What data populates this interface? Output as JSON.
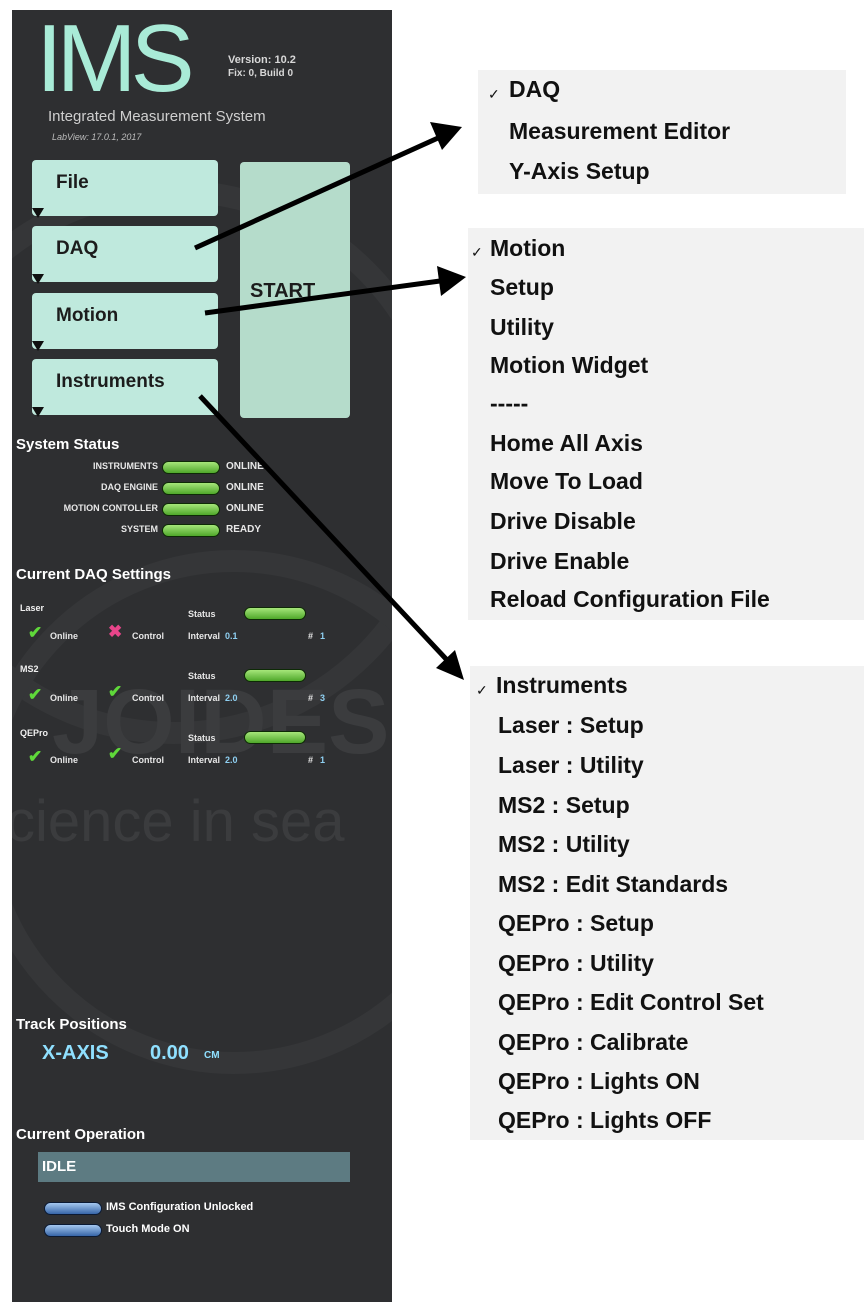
{
  "app": {
    "logo": "IMS",
    "version": "Version: 10.2",
    "build": "Fix: 0, Build 0",
    "subtitle": "Integrated Measurement System",
    "labview": "LabView: 17.0.1, 2017"
  },
  "background_watermark": {
    "text1": "JOIDES",
    "text2": "cience in sea"
  },
  "menu_buttons": [
    {
      "label": "File"
    },
    {
      "label": "DAQ"
    },
    {
      "label": "Motion"
    },
    {
      "label": "Instruments"
    }
  ],
  "start_button": {
    "label": "START"
  },
  "system_status": {
    "heading": "System Status",
    "rows": [
      {
        "label": "INSTRUMENTS",
        "value": "ONLINE"
      },
      {
        "label": "DAQ ENGINE",
        "value": "ONLINE"
      },
      {
        "label": "MOTION CONTOLLER",
        "value": "ONLINE"
      },
      {
        "label": "SYSTEM",
        "value": "READY"
      }
    ]
  },
  "daq_settings": {
    "heading": "Current DAQ Settings",
    "status_label": "Status",
    "online_label": "Online",
    "control_label": "Control",
    "interval_label": "Interval",
    "count_label": "#",
    "instruments": [
      {
        "name": "Laser",
        "online": true,
        "control": false,
        "interval": "0.1",
        "count": "1"
      },
      {
        "name": "MS2",
        "online": true,
        "control": true,
        "interval": "2.0",
        "count": "3"
      },
      {
        "name": "QEPro",
        "online": true,
        "control": true,
        "interval": "2.0",
        "count": "1"
      }
    ]
  },
  "track_positions": {
    "heading": "Track Positions",
    "axis_label": "X-AXIS",
    "value": "0.00",
    "unit": "CM"
  },
  "current_operation": {
    "heading": "Current Operation",
    "status": "IDLE",
    "options": [
      {
        "label": "IMS Configuration Unlocked"
      },
      {
        "label": "Touch Mode ON"
      }
    ]
  },
  "menus": {
    "daq": {
      "check": "✓",
      "items": [
        "DAQ",
        "Measurement Editor",
        "Y-Axis Setup"
      ]
    },
    "motion": {
      "check": "✓",
      "items": [
        "Motion",
        "Setup",
        "Utility",
        "Motion Widget",
        "-----",
        "Home All Axis",
        "Move To Load",
        "Drive Disable",
        "Drive Enable",
        "Reload Configuration File"
      ]
    },
    "instruments": {
      "check": "✓",
      "items": [
        "Instruments",
        "Laser :  Setup",
        "Laser :  Utility",
        "MS2 :  Setup",
        "MS2 :  Utility",
        "MS2 :  Edit Standards",
        "QEPro :  Setup",
        "QEPro :  Utility",
        "QEPro :  Edit Control Set",
        "QEPro :  Calibrate",
        "QEPro :  Lights ON",
        "QEPro :  Lights OFF"
      ]
    }
  },
  "colors": {
    "panel_bg": "#2e2f31",
    "logo": "#a9ebd7",
    "button": "#bfe9dd",
    "start": "#b5dccb",
    "led_green": "#6fcf45",
    "led_blue": "#5a8ed0",
    "cyan_text": "#8fe0ff",
    "op_bar": "#5d7b82",
    "menu_bg": "#f2f2f2"
  }
}
